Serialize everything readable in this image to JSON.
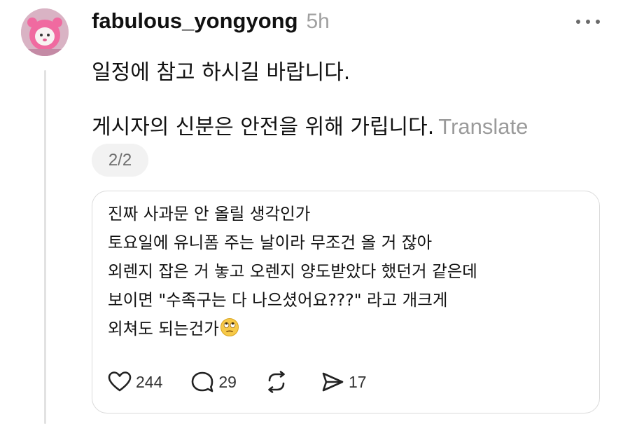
{
  "post": {
    "username": "fabulous_yongyong",
    "timestamp": "5h",
    "more_label": "•••",
    "line1": "일정에 참고 하시길 바랍니다.",
    "line2": "게시자의 신분은 안전을 위해 가립니다.",
    "translate_label": "Translate",
    "page_indicator": "2/2",
    "avatar_icon": "avatar-image"
  },
  "quote": {
    "lines": [
      "진짜 사과문 안 올릴 생각인가",
      "토요일에 유니폼 주는 날이라 무조건 올 거 잖아",
      "외렌지 잡은 거 놓고 오렌지 양도받았다 했던거 같은데",
      "보이면 \"수족구는 다 나으셨어요???\" 라고 개크게",
      "외쳐도 되는건가"
    ],
    "emoji_icon": "face-with-rolling-eyes-icon",
    "actions": {
      "like_count": "244",
      "reply_count": "29",
      "repost_count": "",
      "share_count": "17"
    }
  },
  "colors": {
    "text": "#111111",
    "muted": "#a0a0a0",
    "border": "#dadada",
    "badge_bg": "#f2f2f2"
  }
}
